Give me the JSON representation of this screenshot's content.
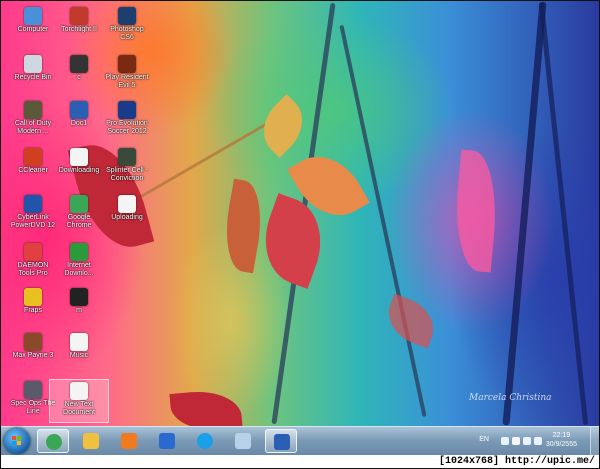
{
  "desktop": {
    "icons": [
      {
        "label": "Computer",
        "icon": "computer-icon",
        "color": "#4a90d9"
      },
      {
        "label": "Torchlight II",
        "icon": "torchlight-icon",
        "color": "#c0392b"
      },
      {
        "label": "Photoshop\nCS6",
        "icon": "photoshop-icon",
        "color": "#1c3f6e"
      },
      {
        "label": "Recycle Bin",
        "icon": "recycle-bin-icon",
        "color": "#cfd8e0"
      },
      {
        "label": "c",
        "icon": "folder-dark-icon",
        "color": "#333333"
      },
      {
        "label": "Play Resident\nEvil 5",
        "icon": "resident-evil-icon",
        "color": "#7a2a10"
      },
      {
        "label": "Call of Duty\nModern ...",
        "icon": "call-of-duty-icon",
        "color": "#5a5a3a"
      },
      {
        "label": "Doc1",
        "icon": "word-doc-icon",
        "color": "#2b5fb4"
      },
      {
        "label": "Pro Evolution\nSoccer 2012",
        "icon": "pes-icon",
        "color": "#1a3a8a"
      },
      {
        "label": "CCleaner",
        "icon": "ccleaner-icon",
        "color": "#d04020"
      },
      {
        "label": "Downloading",
        "icon": "text-file-icon",
        "color": "#f4f4f4"
      },
      {
        "label": "Splinter Cell -\nConviction",
        "icon": "splinter-cell-icon",
        "color": "#3a4a3a"
      },
      {
        "label": "CyberLink\nPowerDVD 12",
        "icon": "powerdvd-icon",
        "color": "#2255aa"
      },
      {
        "label": "Google\nChrome",
        "icon": "chrome-icon",
        "color": "#3aa757"
      },
      {
        "label": "Uploading",
        "icon": "text-file-icon",
        "color": "#f4f4f4"
      },
      {
        "label": "DAEMON\nTools Pro",
        "icon": "daemon-tools-icon",
        "color": "#e04040"
      },
      {
        "label": "Internet\nDownlo...",
        "icon": "idm-icon",
        "color": "#2a9a3a"
      },
      {
        "label": "Fraps",
        "icon": "fraps-icon",
        "color": "#e8c020"
      },
      {
        "label": "m",
        "icon": "folder-dark-icon",
        "color": "#222222"
      },
      {
        "label": "Max Payne 3",
        "icon": "max-payne-icon",
        "color": "#8a4a2a"
      },
      {
        "label": "Music",
        "icon": "text-file-icon",
        "color": "#f4f4f4"
      },
      {
        "label": "Spec Ops The\nLine",
        "icon": "spec-ops-icon",
        "color": "#5a5a6a"
      },
      {
        "label": "New Text\nDocument",
        "icon": "text-file-icon",
        "color": "#f4f4f4"
      }
    ],
    "watermark": "Marcela Christina"
  },
  "taskbar": {
    "items": [
      {
        "name": "chrome-taskbar-icon",
        "color": "#3aa757",
        "active": true
      },
      {
        "name": "explorer-taskbar-icon",
        "color": "#f0c040",
        "active": false
      },
      {
        "name": "media-player-taskbar-icon",
        "color": "#f07a20",
        "active": false
      },
      {
        "name": "network-taskbar-icon",
        "color": "#2a6ad0",
        "active": false
      },
      {
        "name": "skype-taskbar-icon",
        "color": "#1aa0e8",
        "active": false
      },
      {
        "name": "window-taskbar-icon",
        "color": "#b8d0e8",
        "active": false
      },
      {
        "name": "word-taskbar-icon",
        "color": "#2b5fb4",
        "active": true
      }
    ],
    "language": "EN",
    "time": "22:19",
    "date": "30/9/2555"
  },
  "caption": "[1024x768] http://upic.me/"
}
